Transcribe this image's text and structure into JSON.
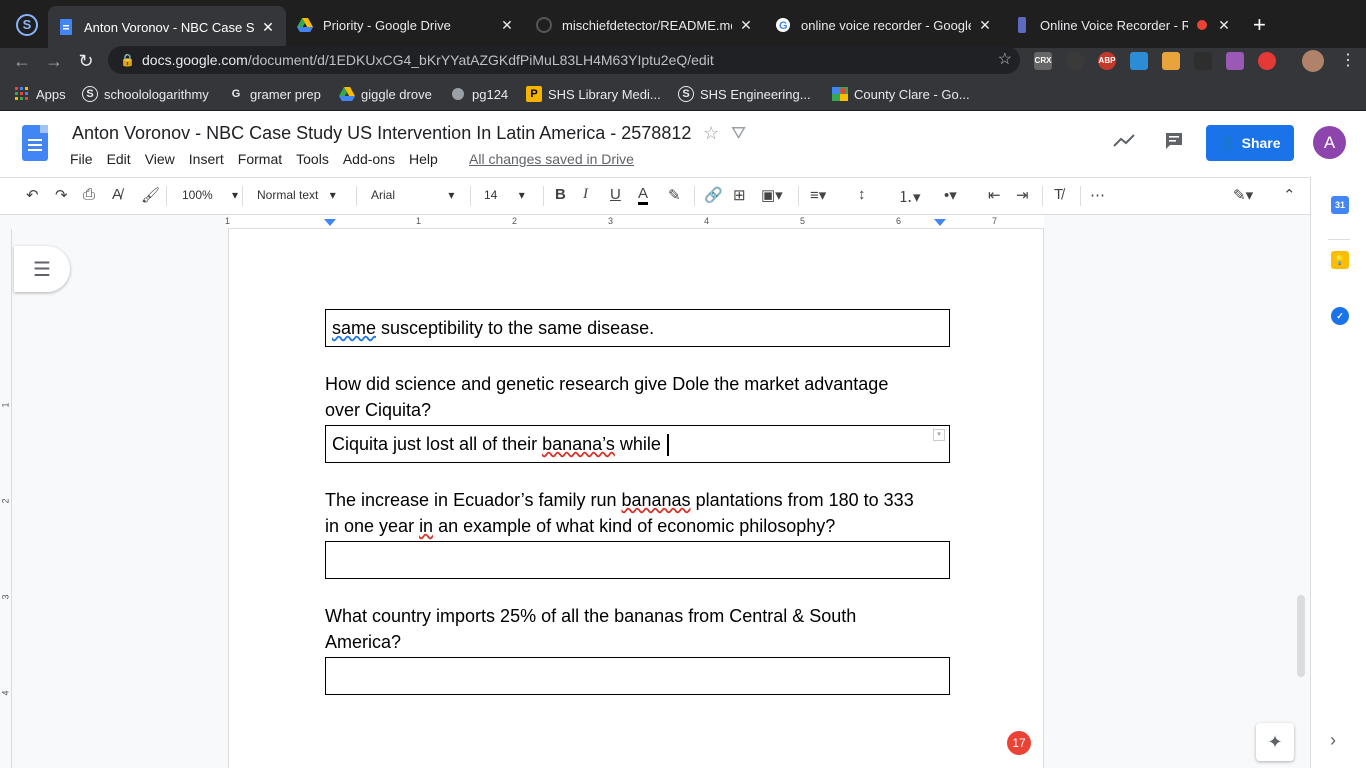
{
  "browser": {
    "tabs": [
      {
        "title": "Anton Voronov - NBC Case Stu",
        "active": true
      },
      {
        "title": "Priority - Google Drive"
      },
      {
        "title": "mischiefdetector/README.md"
      },
      {
        "title": "online voice recorder - Google"
      },
      {
        "title": "Online Voice Recorder - Re"
      }
    ],
    "tab_close": "✕",
    "url_host": "docs.google.com",
    "url_path": "/document/d/1EDKUxCG4_bKrYYatAZGKdfPiMuL83LH4M63YIptu2eQ/edit",
    "extensions": [
      "CRX",
      "ABP"
    ],
    "bookmarks": [
      {
        "label": "Apps"
      },
      {
        "label": "schoolologarithmy"
      },
      {
        "label": "gramer prep"
      },
      {
        "label": "giggle drove"
      },
      {
        "label": "pg124"
      },
      {
        "label": "SHS Library Medi..."
      },
      {
        "label": "SHS Engineering..."
      },
      {
        "label": "County Clare - Go..."
      }
    ]
  },
  "doc": {
    "title": "Anton Voronov - NBC Case Study US Intervention In Latin America - 2578812",
    "menu": [
      "File",
      "Edit",
      "View",
      "Insert",
      "Format",
      "Tools",
      "Add-ons",
      "Help"
    ],
    "save_status": "All changes saved in Drive",
    "share_label": "Share",
    "avatar_letter": "A"
  },
  "toolbar": {
    "zoom": "100%",
    "style": "Normal text",
    "font": "Arial",
    "size": "14"
  },
  "ruler": {
    "numbers": [
      "1",
      "1",
      "2",
      "3",
      "4",
      "5",
      "6",
      "7"
    ],
    "vertical_numbers": [
      "1",
      "2",
      "3",
      "4"
    ]
  },
  "content": {
    "answer1": {
      "squiggle_word": "same",
      "rest": " susceptibility to the same disease."
    },
    "q2_line1": "How did science and genetic research give Dole the market advantage",
    "q2_line2": "over Ciquita?",
    "answer2": {
      "pre": "Ciquita just lost all of their ",
      "squiggle_word": "banana’s",
      "post": " while"
    },
    "q3_line1_pre": "The increase in Ecuador’s family run ",
    "q3_line1_squig": "bananas",
    "q3_line1_post": " plantations from 180 to 333",
    "q3_line2_pre": "in one year ",
    "q3_line2_squig": "in",
    "q3_line2_post": " an example of what kind of economic philosophy?",
    "q4_line1": "What country imports 25% of all the bananas from Central & South",
    "q4_line2": "America?"
  },
  "notification_count": "17"
}
